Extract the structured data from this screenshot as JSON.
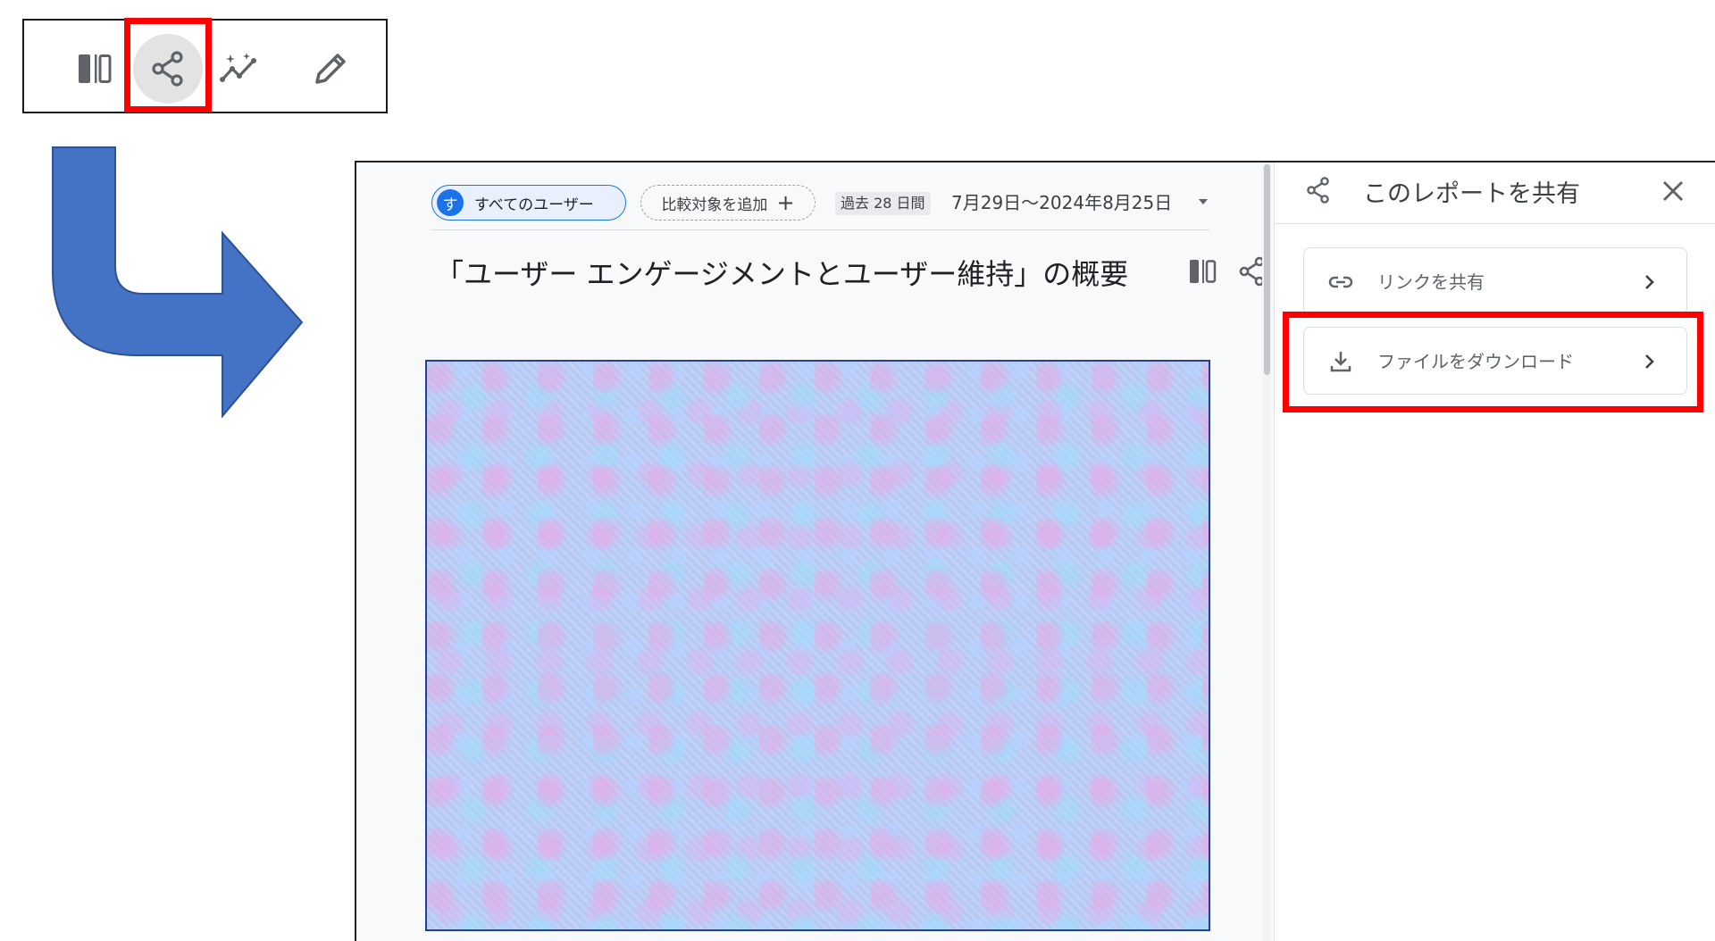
{
  "toolbar": {
    "icons": [
      "compare-icon",
      "share-icon",
      "insights-icon",
      "edit-icon"
    ],
    "highlighted": "share-icon"
  },
  "report": {
    "filter_chip": {
      "avatar_letter": "す",
      "label": "すべてのユーザー"
    },
    "add_compare_label": "比較対象を追加",
    "period_label": "過去 28 日間",
    "date_range": "7月29日～2024年8月25日",
    "title": "「ユーザー エンゲージメントとユーザー維持」の概要"
  },
  "share_panel": {
    "title": "このレポートを共有",
    "options": [
      {
        "label": "リンクを共有",
        "icon": "link-icon"
      },
      {
        "label": "ファイルをダウンロード",
        "icon": "download-icon"
      }
    ]
  },
  "colors": {
    "highlight": "#ff0000",
    "arrow": "#4472c4",
    "accent": "#1a73e8"
  }
}
